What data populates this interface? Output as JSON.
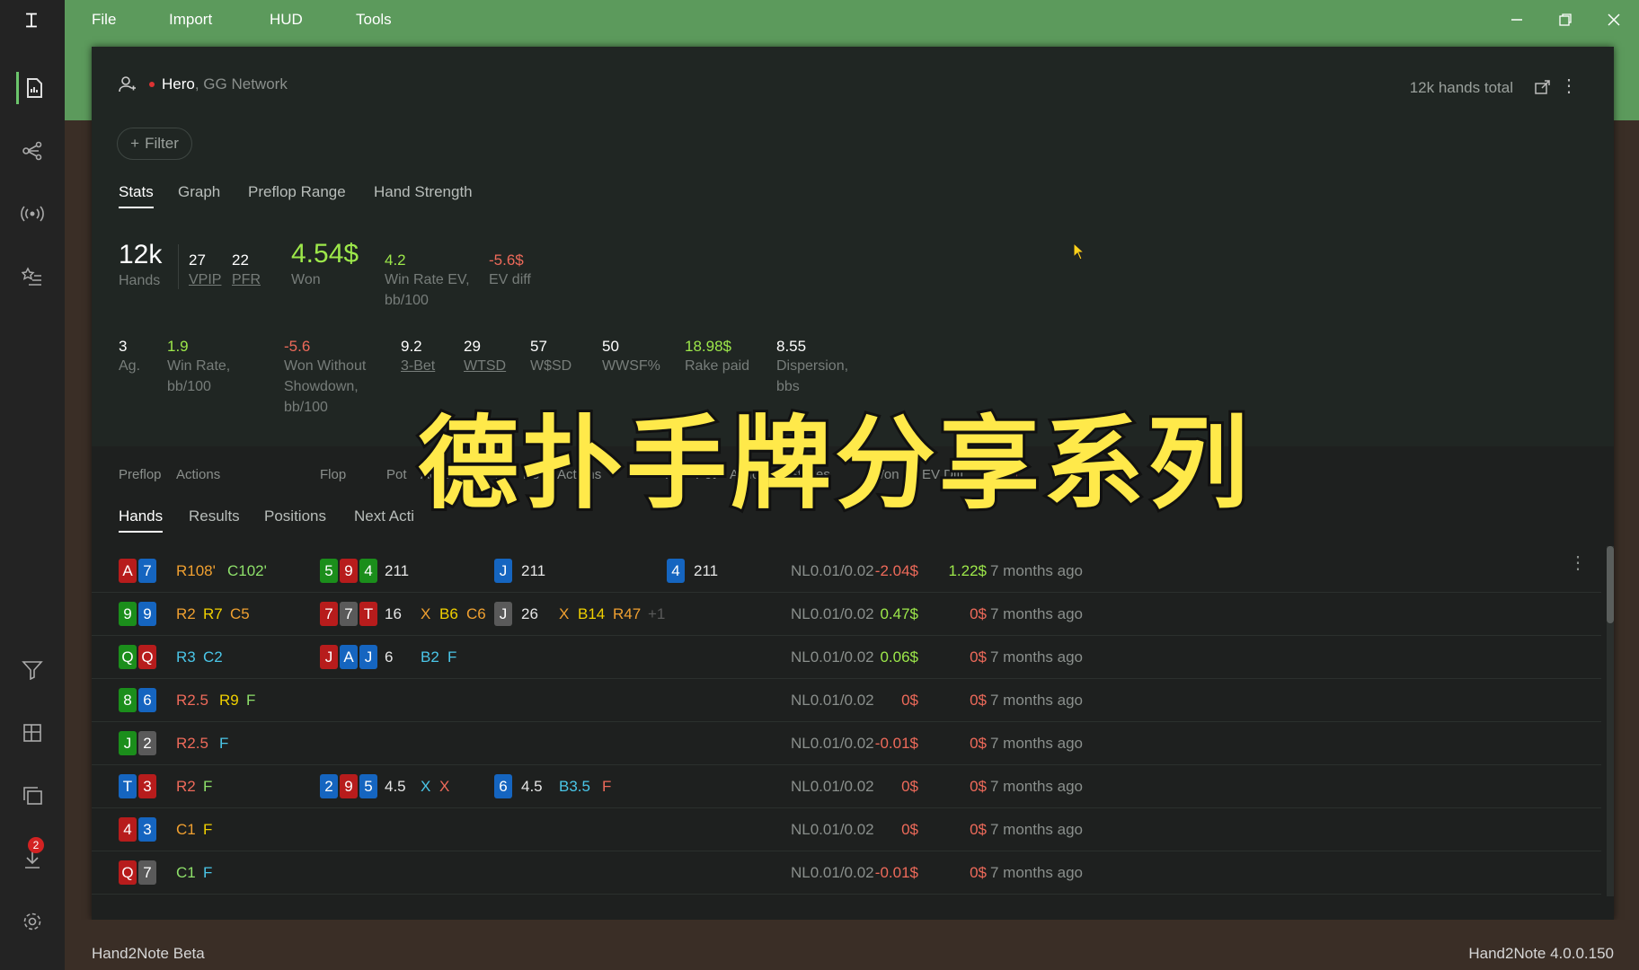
{
  "menu": {
    "items": [
      "File",
      "Import",
      "HUD",
      "Tools"
    ]
  },
  "nav": {
    "items": [
      "reports-icon",
      "graph-share-icon",
      "broadcast-icon",
      "favorites-icon",
      "filter-icon",
      "layout-icon",
      "copy-icon",
      "download-icon",
      "settings-icon"
    ],
    "download_badge": "2"
  },
  "player": {
    "name": "Hero",
    "network": ", GG Network"
  },
  "total_hands": "12k hands total",
  "filter_label": "Filter",
  "stat_tabs": [
    "Stats",
    "Graph",
    "Preflop Range",
    "Hand Strength"
  ],
  "summary": [
    {
      "value": "12k",
      "label": "Hands"
    },
    {
      "value": "27",
      "label": "VPIP"
    },
    {
      "value": "22",
      "label": "PFR"
    },
    {
      "value": "4.54$",
      "label": "Won"
    },
    {
      "value": "4.2",
      "label": "Win Rate EV,",
      "label2": "bb/100"
    },
    {
      "value": "-5.6$",
      "label": "EV diff"
    }
  ],
  "details": [
    {
      "value": "3",
      "label": "Ag."
    },
    {
      "value": "1.9",
      "label": "Win Rate,",
      "label2": "bb/100"
    },
    {
      "value": "-5.6",
      "label": "Won Without",
      "label2": "Showdown,",
      "label3": "bb/100"
    },
    {
      "value": "9.2",
      "label": "3-Bet"
    },
    {
      "value": "29",
      "label": "WTSD"
    },
    {
      "value": "57",
      "label": "W$SD"
    },
    {
      "value": "50",
      "label": "WWSF%"
    },
    {
      "value": "18.98$",
      "label": "Rake paid"
    },
    {
      "value": "8.55",
      "label": "Dispersion,",
      "label2": "bbs"
    }
  ],
  "table_tabs": [
    "Hands",
    "Results",
    "Positions",
    "Next Acti"
  ],
  "columns": [
    "Preflop",
    "Actions",
    "Flop",
    "Pot",
    "Actions",
    "T..",
    "Pot",
    "Actions",
    "R..",
    "Pot",
    "Actions",
    "Stakes",
    "Won",
    "EV Diff.",
    "Date"
  ],
  "colors": {
    "red": "#b71c1c",
    "blue": "#1565c0",
    "green": "#1b8e1b",
    "gray": "#5a5a5a",
    "yellow": "#f0d000",
    "orange": "#f0a030",
    "lightgreen": "#8ee06a",
    "cyan": "#4ac6e8",
    "redtext": "#ee6a5a",
    "plus": "#9de84a"
  },
  "hands": [
    {
      "preflop": [
        {
          "r": "A",
          "c": "red"
        },
        {
          "r": "7",
          "c": "blue"
        }
      ],
      "actions": [
        {
          "t": "R108'",
          "c": "orange"
        },
        {
          "t": "C102'",
          "c": "lightgreen"
        }
      ],
      "flop": [
        {
          "r": "5",
          "c": "green"
        },
        {
          "r": "9",
          "c": "red"
        },
        {
          "r": "4",
          "c": "green"
        }
      ],
      "flop_pot": "211",
      "flop_actions": [],
      "turn": [
        {
          "r": "J",
          "c": "blue"
        }
      ],
      "turn_pot": "211",
      "turn_actions": [],
      "river": [
        {
          "r": "4",
          "c": "blue"
        }
      ],
      "river_pot": "211",
      "stakes": "NL0.01/0.02",
      "won": "-2.04$",
      "won_c": "redtext",
      "ev": "1.22$",
      "ev_c": "plus",
      "date": "7 months ago"
    },
    {
      "preflop": [
        {
          "r": "9",
          "c": "green"
        },
        {
          "r": "9",
          "c": "blue"
        }
      ],
      "actions": [
        {
          "t": "R2",
          "c": "orange"
        },
        {
          "t": "R7",
          "c": "yellow"
        },
        {
          "t": "C5",
          "c": "orange"
        }
      ],
      "flop": [
        {
          "r": "7",
          "c": "red"
        },
        {
          "r": "7",
          "c": "gray"
        },
        {
          "r": "T",
          "c": "red"
        }
      ],
      "flop_pot": "16",
      "flop_actions": [
        {
          "t": "X",
          "c": "orange"
        },
        {
          "t": "B6",
          "c": "yellow"
        },
        {
          "t": "C6",
          "c": "orange"
        }
      ],
      "turn": [
        {
          "r": "J",
          "c": "gray"
        }
      ],
      "turn_pot": "26",
      "turn_actions": [
        {
          "t": "X",
          "c": "orange"
        },
        {
          "t": "B14",
          "c": "yellow"
        },
        {
          "t": "R47",
          "c": "orange"
        },
        {
          "t": "+1",
          "c": "gray"
        }
      ],
      "river": [],
      "river_pot": "",
      "stakes": "NL0.01/0.02",
      "won": "0.47$",
      "won_c": "plus",
      "ev": "0$",
      "ev_c": "redtext",
      "date": "7 months ago"
    },
    {
      "preflop": [
        {
          "r": "Q",
          "c": "green"
        },
        {
          "r": "Q",
          "c": "red"
        }
      ],
      "actions": [
        {
          "t": "R3",
          "c": "cyan"
        },
        {
          "t": "C2",
          "c": "cyan"
        }
      ],
      "flop": [
        {
          "r": "J",
          "c": "red"
        },
        {
          "r": "A",
          "c": "blue"
        },
        {
          "r": "J",
          "c": "blue"
        }
      ],
      "flop_pot": "6",
      "flop_actions": [
        {
          "t": "B2",
          "c": "cyan"
        },
        {
          "t": "F",
          "c": "cyan"
        }
      ],
      "turn": [],
      "turn_pot": "",
      "turn_actions": [],
      "river": [],
      "river_pot": "",
      "stakes": "NL0.01/0.02",
      "won": "0.06$",
      "won_c": "plus",
      "ev": "0$",
      "ev_c": "redtext",
      "date": "7 months ago"
    },
    {
      "preflop": [
        {
          "r": "8",
          "c": "green"
        },
        {
          "r": "6",
          "c": "blue"
        }
      ],
      "actions": [
        {
          "t": "R2.5",
          "c": "redtext"
        },
        {
          "t": "R9",
          "c": "yellow"
        },
        {
          "t": "F",
          "c": "lightgreen"
        }
      ],
      "flop": [],
      "flop_pot": "",
      "flop_actions": [],
      "turn": [],
      "turn_pot": "",
      "turn_actions": [],
      "river": [],
      "river_pot": "",
      "stakes": "NL0.01/0.02",
      "won": "0$",
      "won_c": "redtext",
      "ev": "0$",
      "ev_c": "redtext",
      "date": "7 months ago"
    },
    {
      "preflop": [
        {
          "r": "J",
          "c": "green"
        },
        {
          "r": "2",
          "c": "gray"
        }
      ],
      "actions": [
        {
          "t": "R2.5",
          "c": "redtext"
        },
        {
          "t": "F",
          "c": "cyan"
        }
      ],
      "flop": [],
      "flop_pot": "",
      "flop_actions": [],
      "turn": [],
      "turn_pot": "",
      "turn_actions": [],
      "river": [],
      "river_pot": "",
      "stakes": "NL0.01/0.02",
      "won": "-0.01$",
      "won_c": "redtext",
      "ev": "0$",
      "ev_c": "redtext",
      "date": "7 months ago"
    },
    {
      "preflop": [
        {
          "r": "T",
          "c": "blue"
        },
        {
          "r": "3",
          "c": "red"
        }
      ],
      "actions": [
        {
          "t": "R2",
          "c": "redtext"
        },
        {
          "t": "F",
          "c": "lightgreen"
        }
      ],
      "flop": [
        {
          "r": "2",
          "c": "blue"
        },
        {
          "r": "9",
          "c": "red"
        },
        {
          "r": "5",
          "c": "blue"
        }
      ],
      "flop_pot": "4.5",
      "flop_actions": [
        {
          "t": "X",
          "c": "cyan"
        },
        {
          "t": "X",
          "c": "redtext"
        }
      ],
      "turn": [
        {
          "r": "6",
          "c": "blue"
        }
      ],
      "turn_pot": "4.5",
      "turn_actions": [
        {
          "t": "B3.5",
          "c": "cyan"
        },
        {
          "t": "F",
          "c": "redtext"
        }
      ],
      "river": [],
      "river_pot": "",
      "stakes": "NL0.01/0.02",
      "won": "0$",
      "won_c": "redtext",
      "ev": "0$",
      "ev_c": "redtext",
      "date": "7 months ago"
    },
    {
      "preflop": [
        {
          "r": "4",
          "c": "red"
        },
        {
          "r": "3",
          "c": "blue"
        }
      ],
      "actions": [
        {
          "t": "C1",
          "c": "orange"
        },
        {
          "t": "F",
          "c": "yellow"
        }
      ],
      "flop": [],
      "flop_pot": "",
      "flop_actions": [],
      "turn": [],
      "turn_pot": "",
      "turn_actions": [],
      "river": [],
      "river_pot": "",
      "stakes": "NL0.01/0.02",
      "won": "0$",
      "won_c": "redtext",
      "ev": "0$",
      "ev_c": "redtext",
      "date": "7 months ago"
    },
    {
      "preflop": [
        {
          "r": "Q",
          "c": "red"
        },
        {
          "r": "7",
          "c": "gray"
        }
      ],
      "actions": [
        {
          "t": "C1",
          "c": "lightgreen"
        },
        {
          "t": "F",
          "c": "cyan"
        }
      ],
      "flop": [],
      "flop_pot": "",
      "flop_actions": [],
      "turn": [],
      "turn_pot": "",
      "turn_actions": [],
      "river": [],
      "river_pot": "",
      "stakes": "NL0.01/0.02",
      "won": "-0.01$",
      "won_c": "redtext",
      "ev": "0$",
      "ev_c": "redtext",
      "date": "7 months ago"
    }
  ],
  "overlay_title": "德扑手牌分享系列",
  "status": {
    "left": "Hand2Note Beta",
    "right": "Hand2Note 4.0.0.150"
  }
}
